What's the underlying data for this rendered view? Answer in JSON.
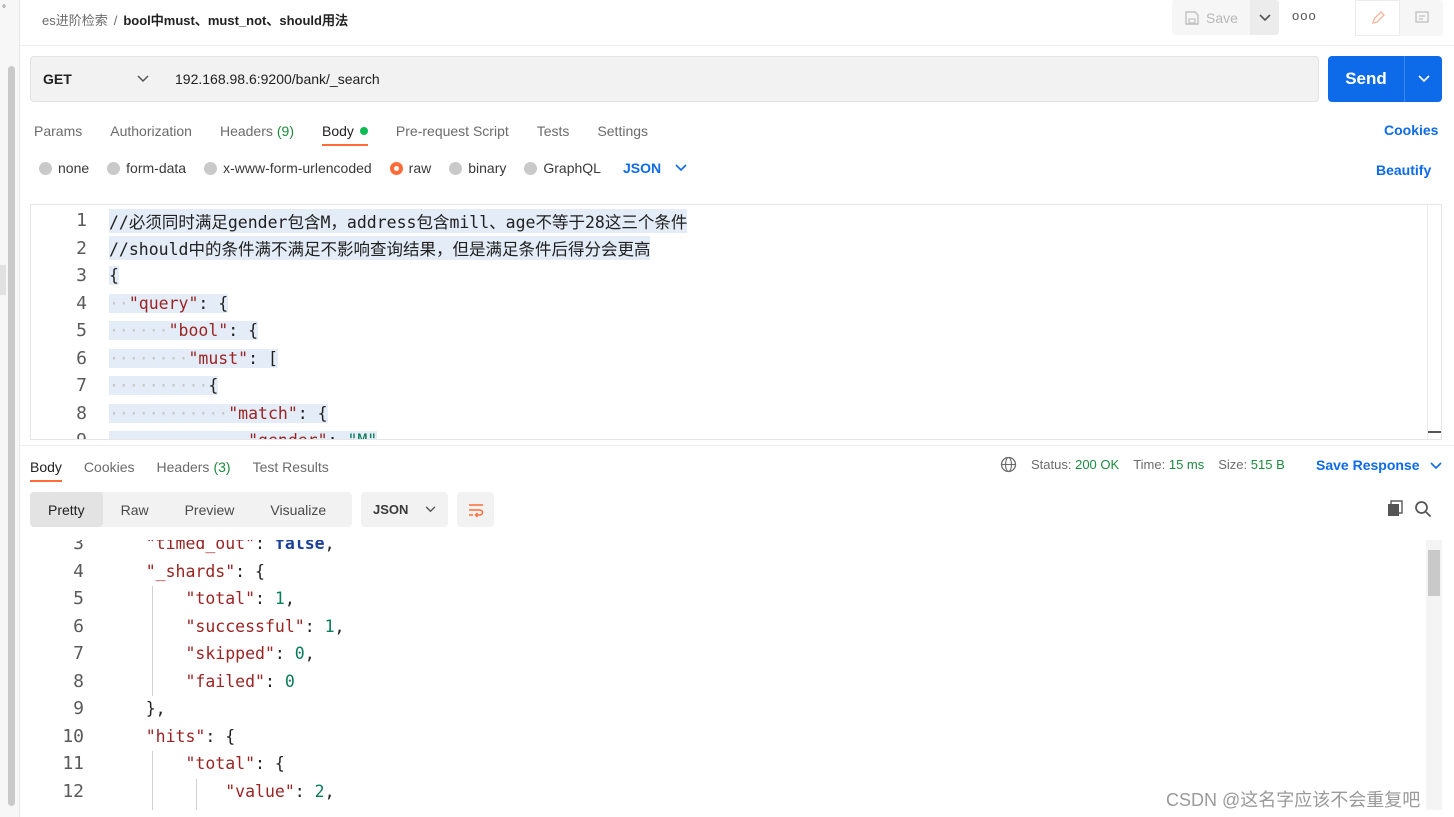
{
  "header": {
    "parent": "es进阶检索",
    "separator": "/",
    "current": "bool中must、must_not、should用法",
    "save_label": "Save",
    "more_label": "ooo"
  },
  "request": {
    "method": "GET",
    "url": "192.168.98.6:9200/bank/_search",
    "send_label": "Send"
  },
  "req_tabs": {
    "params": "Params",
    "authorization": "Authorization",
    "headers": "Headers",
    "headers_count": "(9)",
    "body": "Body",
    "prerequest": "Pre-request Script",
    "tests": "Tests",
    "settings": "Settings",
    "cookies": "Cookies"
  },
  "body_types": {
    "none": "none",
    "form_data": "form-data",
    "urlencoded": "x-www-form-urlencoded",
    "raw": "raw",
    "binary": "binary",
    "graphql": "GraphQL",
    "format": "JSON",
    "beautify": "Beautify"
  },
  "editor": {
    "line_numbers": [
      "1",
      "2",
      "3",
      "4",
      "5",
      "6",
      "7",
      "8",
      "9"
    ],
    "line1": "//必须同时满足gender包含M，address包含mill、age不等于28这三个条件",
    "line2": "//should中的条件满不满足不影响查询结果，但是满足条件后得分会更高",
    "line3": "{",
    "line4_key": "\"query\"",
    "line4_rest": ": {",
    "line5_key": "\"bool\"",
    "line5_rest": ": {",
    "line6_key": "\"must\"",
    "line6_rest": ": [",
    "line7": "{",
    "line8_key": "\"match\"",
    "line8_rest": ": {",
    "line9_key": "\"gender\"",
    "line9_rest": ": ",
    "line9_val": "\"M\""
  },
  "response": {
    "tabs": {
      "body": "Body",
      "cookies": "Cookies",
      "headers": "Headers",
      "headers_count": "(3)",
      "tests": "Test Results"
    },
    "status_label": "Status:",
    "status_value": "200 OK",
    "time_label": "Time:",
    "time_value": "15 ms",
    "size_label": "Size:",
    "size_value": "515 B",
    "save_response": "Save Response",
    "views": [
      "Pretty",
      "Raw",
      "Preview",
      "Visualize"
    ],
    "format": "JSON",
    "lines": {
      "n3": "3",
      "l3_key": "\"timed_out\"",
      "l3_sep": ": ",
      "l3_val": "false",
      "l3_end": ",",
      "n4": "4",
      "l4_key": "\"_shards\"",
      "l4_rest": ": {",
      "n5": "5",
      "l5_key": "\"total\"",
      "l5_sep": ": ",
      "l5_val": "1",
      "l5_end": ",",
      "n6": "6",
      "l6_key": "\"successful\"",
      "l6_sep": ": ",
      "l6_val": "1",
      "l6_end": ",",
      "n7": "7",
      "l7_key": "\"skipped\"",
      "l7_sep": ": ",
      "l7_val": "0",
      "l7_end": ",",
      "n8": "8",
      "l8_key": "\"failed\"",
      "l8_sep": ": ",
      "l8_val": "0",
      "n9": "9",
      "l9": "},",
      "n10": "10",
      "l10_key": "\"hits\"",
      "l10_rest": ": {",
      "n11": "11",
      "l11_key": "\"total\"",
      "l11_rest": ": {",
      "n12": "12",
      "l12_key": "\"value\"",
      "l12_sep": ": ",
      "l12_val": "2",
      "l12_end": ","
    }
  },
  "watermark": "CSDN @这名字应该不会重复吧"
}
